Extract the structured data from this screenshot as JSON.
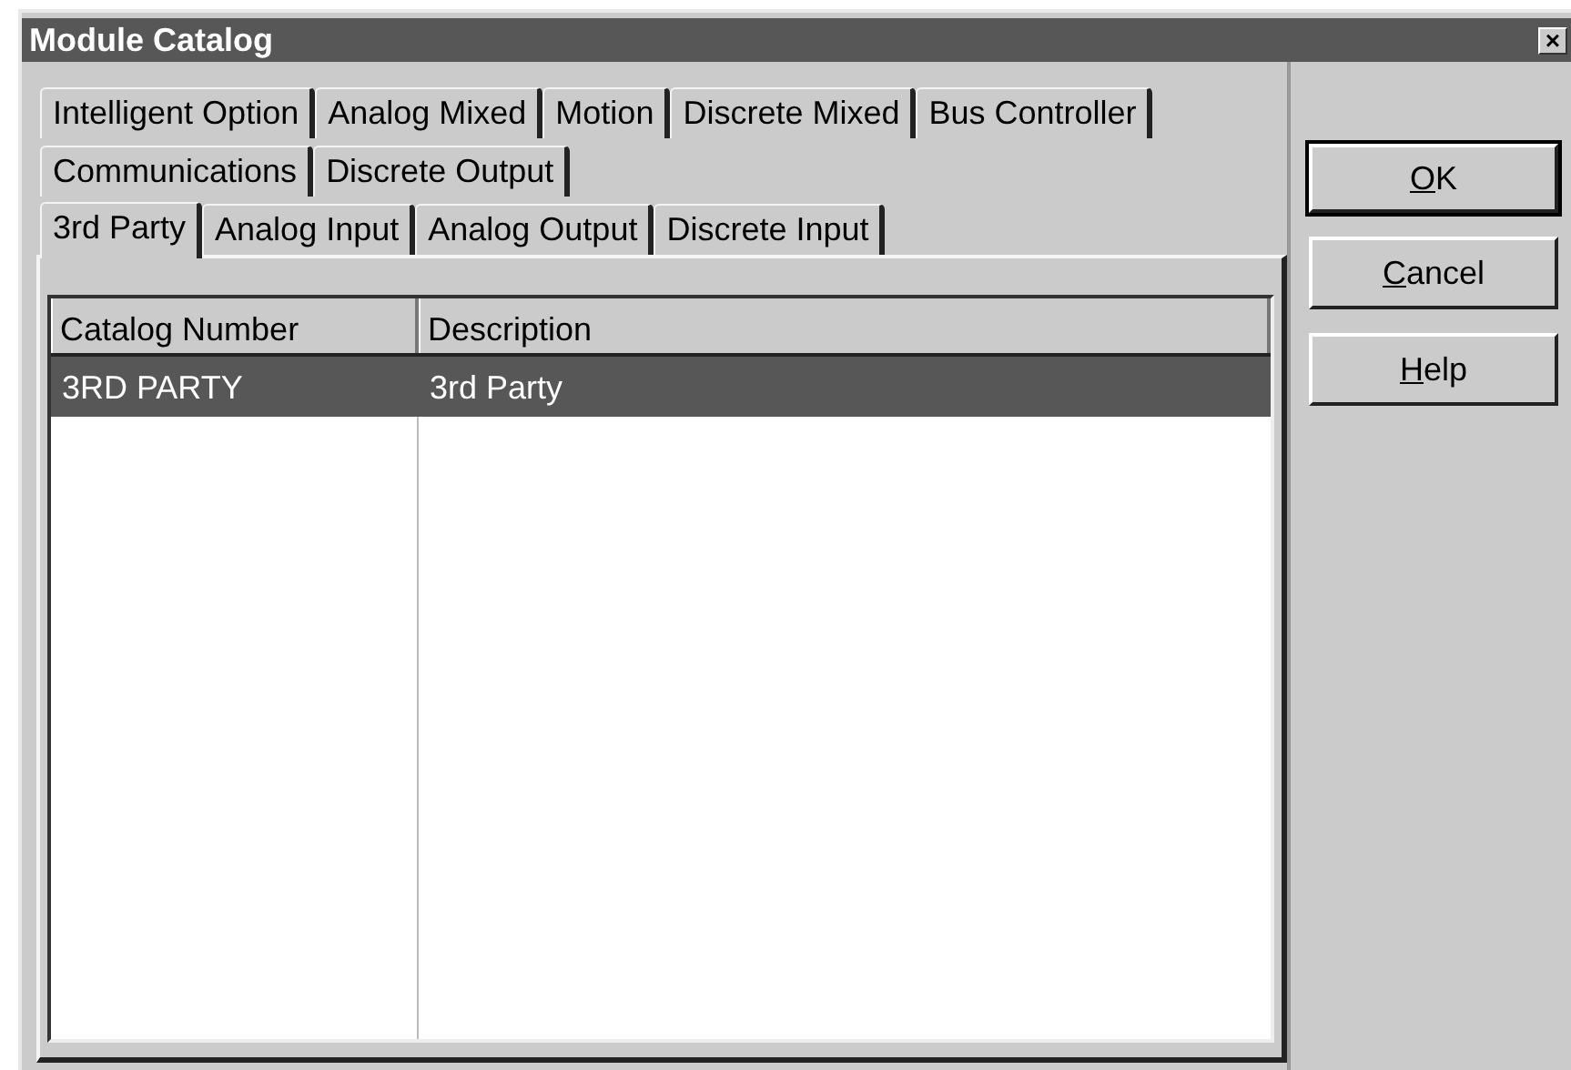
{
  "window": {
    "title": "Module Catalog",
    "close": "×"
  },
  "tab_rows": [
    [
      {
        "label": "Intelligent Option",
        "selected": false
      },
      {
        "label": "Analog Mixed",
        "selected": false
      },
      {
        "label": "Motion",
        "selected": false
      },
      {
        "label": "Discrete Mixed",
        "selected": false
      },
      {
        "label": "Bus Controller",
        "selected": false
      }
    ],
    [
      {
        "label": "Communications",
        "selected": false
      },
      {
        "label": "Discrete Output",
        "selected": false
      }
    ],
    [
      {
        "label": "3rd Party",
        "selected": true
      },
      {
        "label": "Analog Input",
        "selected": false
      },
      {
        "label": "Analog Output",
        "selected": false
      },
      {
        "label": "Discrete Input",
        "selected": false
      }
    ]
  ],
  "list": {
    "columns": [
      "Catalog Number",
      "Description"
    ],
    "rows": [
      {
        "cells": [
          "3RD PARTY",
          "3rd Party"
        ],
        "selected": true
      }
    ]
  },
  "buttons": [
    {
      "label": "OK",
      "default": true,
      "underline_first": true
    },
    {
      "label": "Cancel",
      "default": false,
      "underline_first": true
    },
    {
      "label": "Help",
      "default": false,
      "underline_first": true
    }
  ]
}
